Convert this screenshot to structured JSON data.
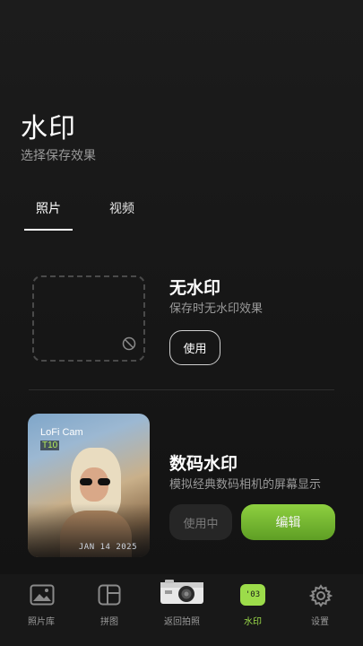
{
  "header": {
    "title": "水印",
    "subtitle": "选择保存效果"
  },
  "tabs": [
    {
      "label": "照片",
      "active": true
    },
    {
      "label": "视频",
      "active": false
    }
  ],
  "watermarks": [
    {
      "title": "无水印",
      "description": "保存时无水印效果",
      "button_label": "使用",
      "icon": "ban-icon"
    },
    {
      "title": "数码水印",
      "description": "模拟经典数码相机的屏幕显示",
      "preview": {
        "camera_name": "LoFi Cam",
        "camera_model": "T10",
        "date_stamp": "JAN 14 2025"
      },
      "in_use_label": "使用中",
      "edit_label": "编辑"
    }
  ],
  "nav": [
    {
      "label": "照片库",
      "icon": "gallery-icon",
      "active": false
    },
    {
      "label": "拼图",
      "icon": "collage-icon",
      "active": false
    },
    {
      "label": "返回拍照",
      "icon": "camera-icon",
      "active": false
    },
    {
      "label": "水印",
      "icon": "watermark-icon",
      "badge": "'03",
      "active": true
    },
    {
      "label": "设置",
      "icon": "gear-icon",
      "active": false
    }
  ],
  "colors": {
    "background": "#161616",
    "accent": "#8ed040",
    "muted_text": "#9a9a9a"
  }
}
